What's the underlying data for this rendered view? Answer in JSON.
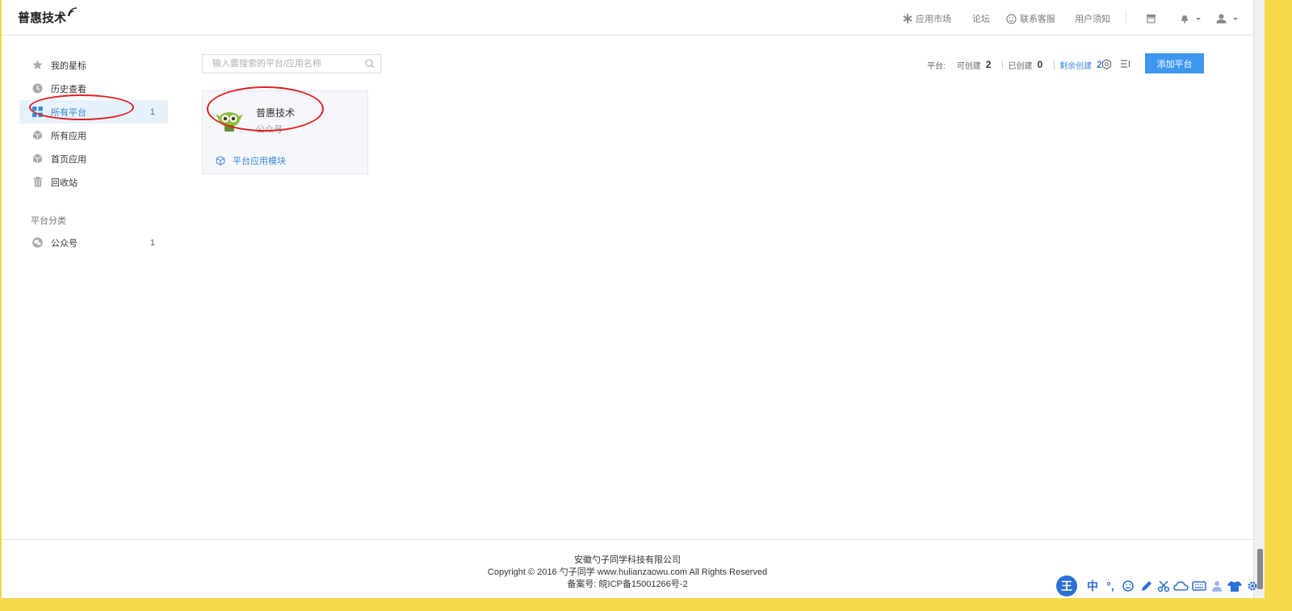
{
  "header": {
    "logo": "普惠技术",
    "nav": {
      "app_market": "应用市场",
      "forum": "论坛",
      "support": "联系客服",
      "notice": "用户须知"
    }
  },
  "sidebar": {
    "items": [
      {
        "label": "我的星标",
        "count": "",
        "icon": "star-icon"
      },
      {
        "label": "历史查看",
        "count": "",
        "icon": "clock-icon"
      },
      {
        "label": "所有平台",
        "count": "1",
        "icon": "grid-icon",
        "active": true
      },
      {
        "label": "所有应用",
        "count": "",
        "icon": "cube-icon"
      },
      {
        "label": "首页应用",
        "count": "",
        "icon": "cube-icon"
      },
      {
        "label": "回收站",
        "count": "",
        "icon": "trash-icon"
      }
    ],
    "category_title": "平台分类",
    "categories": [
      {
        "label": "公众号",
        "count": "1",
        "icon": "wechat-icon"
      }
    ]
  },
  "search": {
    "placeholder": "输入要搜索的平台/应用名称"
  },
  "stats": {
    "platform_label": "平台:",
    "can_create_label": "可创建",
    "can_create_value": "2",
    "created_label": "已创建",
    "created_value": "0",
    "remaining_label": "剩余创建",
    "remaining_value": "2"
  },
  "actions": {
    "add_platform": "添加平台"
  },
  "card": {
    "name": "普惠技术",
    "type": "公众号",
    "module_link": "平台应用模块"
  },
  "footer": {
    "company": "安徽勺子同学科技有限公司",
    "copyright": "Copyright © 2016 勺子同学 www.hulianzaowu.com All Rights Reserved",
    "icp": "备案号: 皖ICP备15001266号-2"
  },
  "ime": {
    "badge": "王",
    "mode": "中",
    "punct": "°,"
  },
  "colors": {
    "accent": "#3d97ef",
    "active_bg": "#e6f1fc",
    "annotation": "#e02020"
  }
}
